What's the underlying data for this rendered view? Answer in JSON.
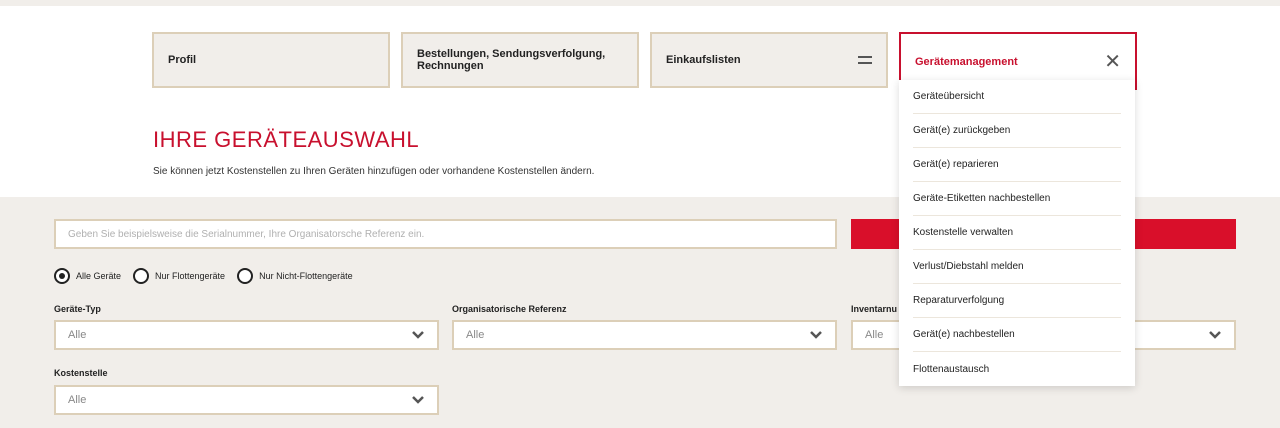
{
  "tabs": [
    {
      "label": "Profil"
    },
    {
      "label": "Bestellungen, Sendungsverfolgung, Rechnungen"
    },
    {
      "label": "Einkaufslisten"
    },
    {
      "label": "Gerätemanagement"
    }
  ],
  "colors": {
    "accent": "#c8102e",
    "border": "#dccfb8",
    "background": "#f1eeea"
  },
  "heading": "IHRE GERÄTEAUSWAHL",
  "subtext": "Sie können jetzt Kostenstellen zu Ihren Geräten hinzufügen oder vorhandene Kostenstellen ändern.",
  "search": {
    "placeholder": "Geben Sie beispielsweise die Serialnummer, Ihre Organisatorsche Referenz ein."
  },
  "radios": [
    {
      "label": "Alle Geräte",
      "selected": true
    },
    {
      "label": "Nur Flottengeräte",
      "selected": false
    },
    {
      "label": "Nur Nicht-Flottengeräte",
      "selected": false
    }
  ],
  "filters": {
    "type": {
      "label": "Geräte-Typ",
      "value": "Alle"
    },
    "org": {
      "label": "Organisatorische Referenz",
      "value": "Alle"
    },
    "inventory": {
      "label": "Inventarnu",
      "value": "Alle"
    },
    "cost": {
      "label": "Kostenstelle",
      "value": "Alle"
    }
  },
  "dropdown": [
    "Geräteübersicht",
    "Gerät(e) zurückgeben",
    "Gerät(e) reparieren",
    "Geräte-Etiketten nachbestellen",
    "Kostenstelle verwalten",
    "Verlust/Diebstahl melden",
    "Reparaturverfolgung",
    "Gerät(e) nachbestellen",
    "Flottenaustausch"
  ],
  "icons": {
    "menu": "equals-icon",
    "close": "close-icon",
    "chevron": "chevron-down-icon"
  }
}
